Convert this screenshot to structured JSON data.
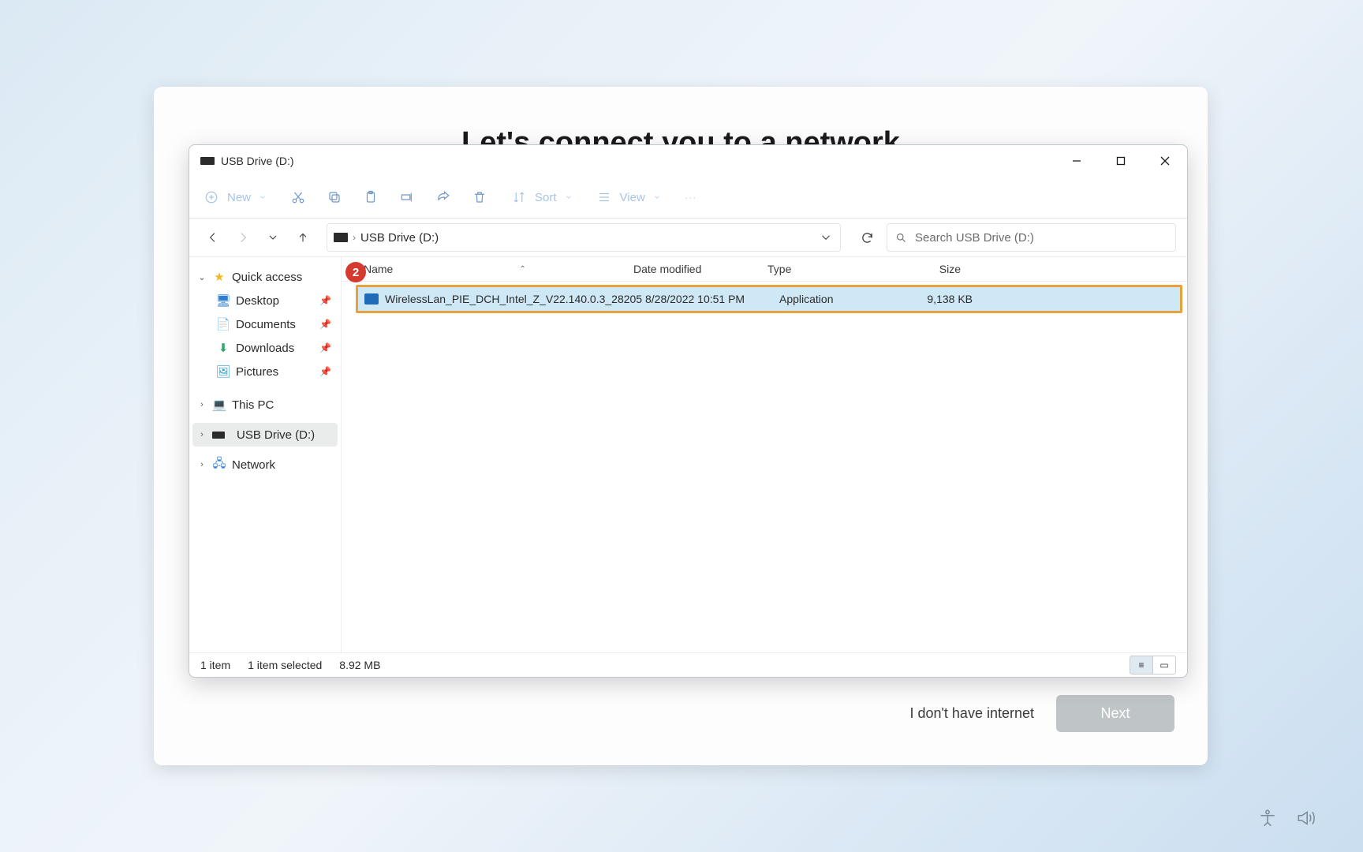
{
  "oobe": {
    "title": "Let's connect you to a network",
    "no_internet": "I don't have internet",
    "next": "Next"
  },
  "explorer": {
    "title": "USB Drive (D:)",
    "cmd": {
      "new": "New",
      "sort": "Sort",
      "view": "View",
      "more": "···"
    },
    "breadcrumb": "USB Drive (D:)",
    "search_placeholder": "Search USB Drive (D:)",
    "sidebar": {
      "quick_access": "Quick access",
      "desktop": "Desktop",
      "documents": "Documents",
      "downloads": "Downloads",
      "pictures": "Pictures",
      "this_pc": "This PC",
      "usb": "USB Drive (D:)",
      "network": "Network"
    },
    "columns": {
      "name": "Name",
      "date": "Date modified",
      "type": "Type",
      "size": "Size"
    },
    "file": {
      "name": "WirelessLan_PIE_DCH_Intel_Z_V22.140.0.3_28205",
      "date": "8/28/2022 10:51 PM",
      "type": "Application",
      "size": "9,138 KB"
    },
    "status": {
      "count": "1 item",
      "selected": "1 item selected",
      "sel_size": "8.92 MB"
    },
    "annotation_number": "2"
  }
}
